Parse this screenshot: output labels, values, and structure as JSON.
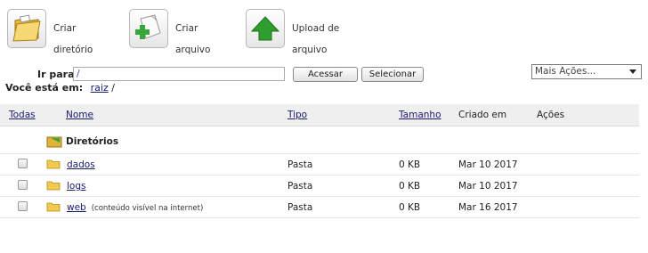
{
  "toolbar": {
    "create_dir": {
      "line1": "Criar",
      "line2": "diretório",
      "icon": "folder-icon"
    },
    "create_file": {
      "line1": "Criar",
      "line2": "arquivo",
      "icon": "new-file-icon"
    },
    "upload_file": {
      "line1": "Upload de",
      "line2": "arquivo",
      "icon": "upload-arrow-icon"
    }
  },
  "nav": {
    "go_to_label": "Ir para:",
    "path_value": "/",
    "access_button": "Acessar",
    "select_button": "Selecionar",
    "more_actions": "Mais Ações...",
    "you_are_in_label": "Você está em:",
    "breadcrumb_root": "raiz",
    "breadcrumb_sep": "/"
  },
  "table": {
    "headers": {
      "all": "Todas",
      "name": "Nome",
      "type": "Tipo",
      "size": "Tamanho",
      "created": "Criado em",
      "actions": "Ações"
    },
    "section_label": "Diretórios",
    "rows": [
      {
        "name": "dados",
        "note": "",
        "type": "Pasta",
        "size": "0 KB",
        "created": "Mar 10 2017"
      },
      {
        "name": "logs",
        "note": "",
        "type": "Pasta",
        "size": "0 KB",
        "created": "Mar 10 2017"
      },
      {
        "name": "web",
        "note": "(conteúdo visível na internet)",
        "type": "Pasta",
        "size": "0 KB",
        "created": "Mar 16 2017"
      }
    ]
  },
  "colors": {
    "link": "#1a1a6e",
    "folder": "#f2c94c",
    "arrow_green": "#2e9e2e",
    "header_bg": "#efefef"
  }
}
